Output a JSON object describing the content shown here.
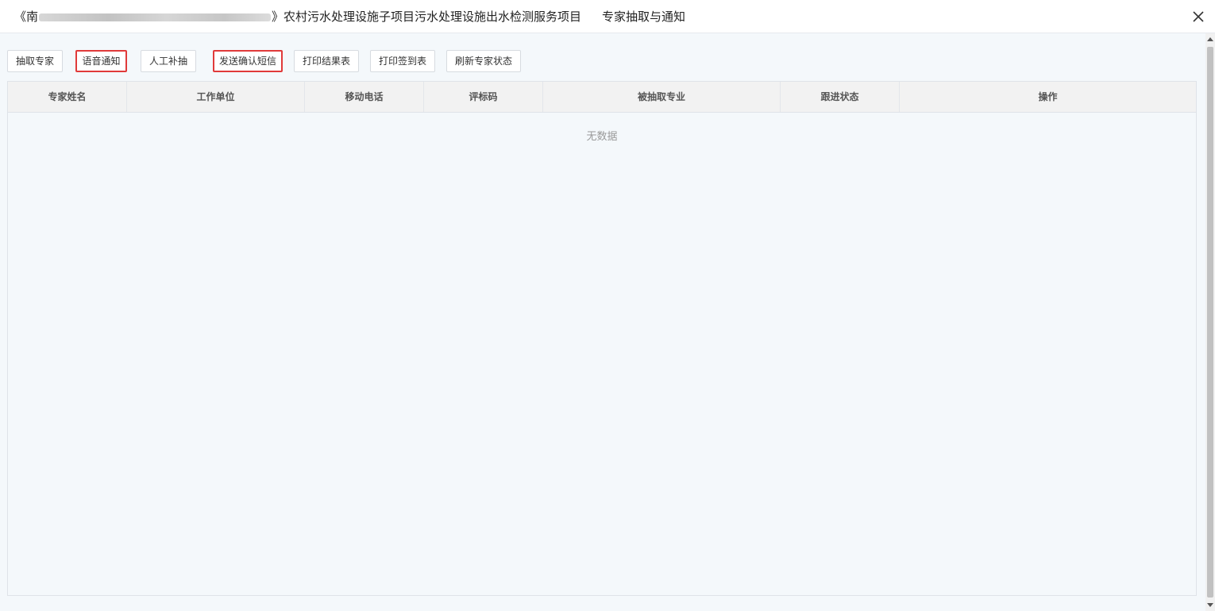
{
  "dialog": {
    "title_prefix": "《南",
    "title_suffix": "》农村污水处理设施子项目污水处理设施出水检测服务项目",
    "subtitle": "专家抽取与通知",
    "close_icon": "close-icon"
  },
  "toolbar": {
    "buttons": [
      {
        "label": "抽取专家",
        "highlighted": false
      },
      {
        "label": "语音通知",
        "highlighted": true
      },
      {
        "label": "人工补抽",
        "highlighted": false
      },
      {
        "label": "发送确认短信",
        "highlighted": true
      },
      {
        "label": "打印结果表",
        "highlighted": false
      },
      {
        "label": "打印签到表",
        "highlighted": false
      },
      {
        "label": "刷新专家状态",
        "highlighted": false
      }
    ],
    "highlight_color": "#e03a3a"
  },
  "table": {
    "columns": [
      "专家姓名",
      "工作单位",
      "移动电话",
      "评标码",
      "被抽取专业",
      "跟进状态",
      "操作"
    ],
    "rows": [],
    "empty_text": "无数据"
  }
}
